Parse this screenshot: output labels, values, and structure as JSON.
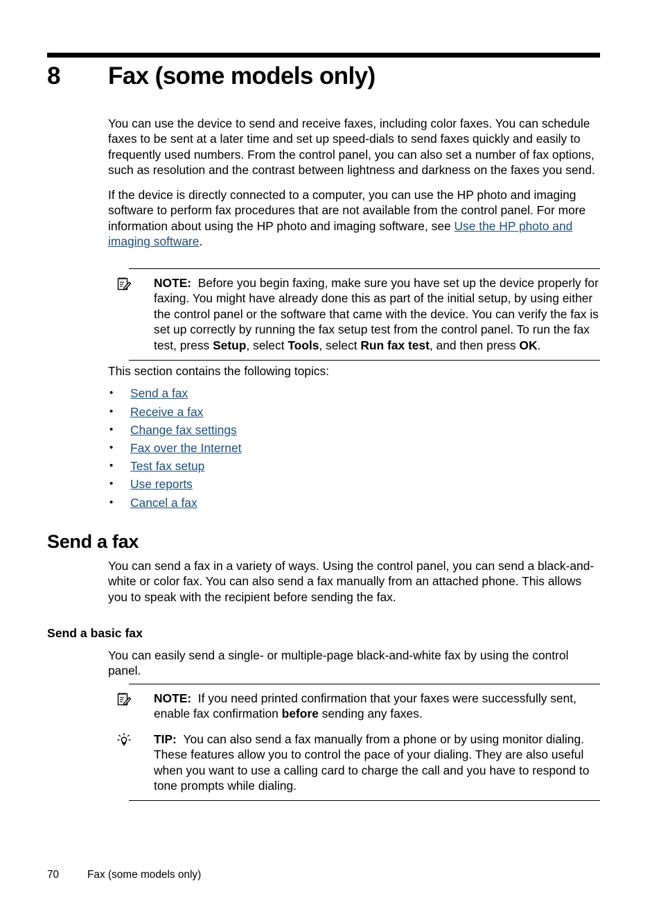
{
  "chapter": {
    "number": "8",
    "title": "Fax (some models only)"
  },
  "intro": {
    "paragraph_1": "You can use the device to send and receive faxes, including color faxes. You can schedule faxes to be sent at a later time and set up speed-dials to send faxes quickly and easily to frequently used numbers. From the control panel, you can also set a number of fax options, such as resolution and the contrast between lightness and darkness on the faxes you send.",
    "paragraph_2_before_link": "If the device is directly connected to a computer, you can use the HP photo and imaging software to perform fax procedures that are not available from the control panel. For more information about using the HP photo and imaging software, see ",
    "paragraph_2_link": "Use the HP photo and imaging software",
    "paragraph_2_after_link": "."
  },
  "note_1": {
    "icon": "note-pencil-icon",
    "label": "NOTE:",
    "text_1": "Before you begin faxing, make sure you have set up the device properly for faxing. You might have already done this as part of the initial setup, by using either the control panel or the software that came with the device. You can verify the fax is set up correctly by running the fax setup test from the control panel. To run the fax test, press ",
    "bold_1": "Setup",
    "text_2": ", select ",
    "bold_2": "Tools",
    "text_3": ", select ",
    "bold_3": "Run fax test",
    "text_4": ", and then press ",
    "bold_4": "OK",
    "text_5": "."
  },
  "topics": {
    "intro": "This section contains the following topics:",
    "items": [
      {
        "label": "Send a fax"
      },
      {
        "label": "Receive a fax"
      },
      {
        "label": "Change fax settings"
      },
      {
        "label": "Fax over the Internet"
      },
      {
        "label": "Test fax setup"
      },
      {
        "label": "Use reports"
      },
      {
        "label": "Cancel a fax"
      }
    ]
  },
  "send_a_fax": {
    "heading": "Send a fax",
    "paragraph": "You can send a fax in a variety of ways. Using the control panel, you can send a black-and-white or color fax. You can also send a fax manually from an attached phone. This allows you to speak with the recipient before sending the fax."
  },
  "send_basic_fax": {
    "heading": "Send a basic fax",
    "paragraph": "You can easily send a single- or multiple-page black-and-white fax by using the control panel."
  },
  "note_2": {
    "icon": "note-pencil-icon",
    "label": "NOTE:",
    "text_1": "If you need printed confirmation that your faxes were successfully sent, enable fax confirmation ",
    "bold_1": "before",
    "text_2": " sending any faxes."
  },
  "tip_1": {
    "icon": "lightbulb-icon",
    "label": "TIP:",
    "text_1": "You can also send a fax manually from a phone or by using monitor dialing. These features allow you to control the pace of your dialing. They are also useful when you want to use a calling card to charge the call and you have to respond to tone prompts while dialing."
  },
  "footer": {
    "page_number": "70",
    "chapter_label": "Fax (some models only)"
  },
  "colors": {
    "link": "#1b4f80",
    "text": "#000000",
    "rule": "#000000",
    "background": "#ffffff"
  }
}
